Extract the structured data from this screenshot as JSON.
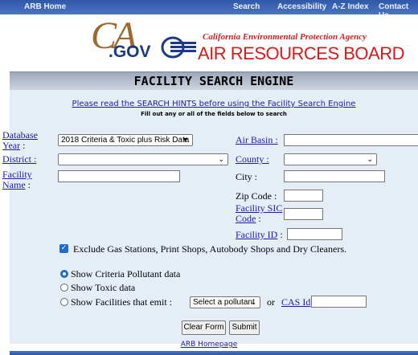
{
  "topnav": {
    "home": "ARB Home",
    "search": "Search",
    "accessibility": "Accessibility",
    "az_index": "A-Z Index",
    "contact": "Contact Us"
  },
  "logos": {
    "ca": "CA",
    "gov": ".GOV",
    "calepa": "California Environmental Protection Agency",
    "arb": "AIR RESOURCES BOARD"
  },
  "title": "FACILITY SEARCH ENGINE",
  "hints": {
    "link": "Please read the SEARCH HINTS before using the Facility Search Engine",
    "instruction": "Fill out any or all of the fields below to search"
  },
  "form": {
    "database_year_label_1": "Database",
    "database_year_label_2": "Year",
    "database_year_colon": " :",
    "database_year_value": "2018 Criteria & Toxic plus Risk Data",
    "air_basin_label": "Air Basin :",
    "air_basin_value": "",
    "district_label": "District :",
    "district_value": "",
    "county_label": "County :",
    "county_value": "",
    "facility_name_label_1": "Facility",
    "facility_name_label_2": "Name",
    "facility_name_colon": " :",
    "facility_name_value": "",
    "city_label": "City :",
    "city_value": "",
    "zip_label": "Zip Code :",
    "zip_value": "",
    "sic_label_1": "Facility SIC",
    "sic_label_2": "Code",
    "sic_colon": " :",
    "sic_value": "",
    "facility_id_label": "Facility ID",
    "facility_id_colon": " :",
    "facility_id_value": "",
    "exclude_label": "Exclude Gas Stations, Print Shops, Autobody Shops and Dry Cleaners.",
    "exclude_checked": true,
    "radio_criteria": "Show Criteria Pollutant data",
    "radio_toxic": "Show Toxic data",
    "radio_emit": "Show Facilities that emit :",
    "radio_selected": "criteria",
    "pollutant_value": "Select a pollutant",
    "or_label": "or",
    "cas_label": "CAS Id",
    "cas_value": ""
  },
  "buttons": {
    "clear": "Clear Form",
    "submit": "Submit"
  },
  "footer": {
    "link": "ARB Homepage"
  },
  "colors": {
    "nav_blue": "#2f59a8",
    "panel": "#e5eef7",
    "link": "#1a1aa6",
    "arb_red": "#d61a1a",
    "check_blue": "#1c6bd1"
  }
}
